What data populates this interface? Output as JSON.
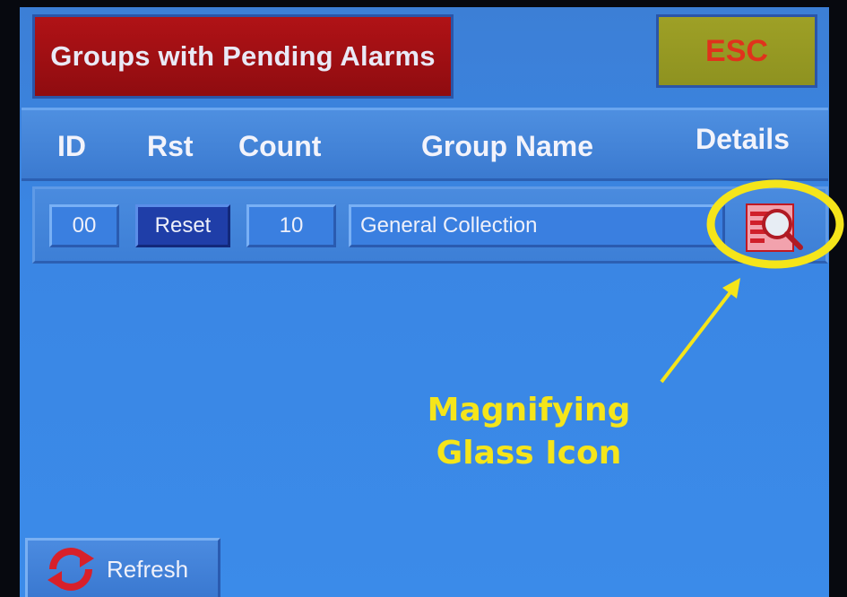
{
  "title": "Groups with Pending Alarms",
  "esc_label": "ESC",
  "columns": {
    "id": "ID",
    "rst": "Rst",
    "count": "Count",
    "group_name": "Group Name",
    "details": "Details"
  },
  "rows": [
    {
      "id": "00",
      "reset_label": "Reset",
      "count": "10",
      "group_name": "General Collection",
      "details_icon": "magnifying-glass-document-icon"
    }
  ],
  "annotation": {
    "line1": "Magnifying",
    "line2": "Glass Icon",
    "color": "#f5e51a"
  },
  "refresh_label": "Refresh",
  "colors": {
    "title_bg": "#a30f13",
    "esc_bg": "#979a23",
    "esc_text": "#e0321c",
    "screen_bg": "#3a86e4",
    "reset_bg": "#1f3ea8"
  }
}
